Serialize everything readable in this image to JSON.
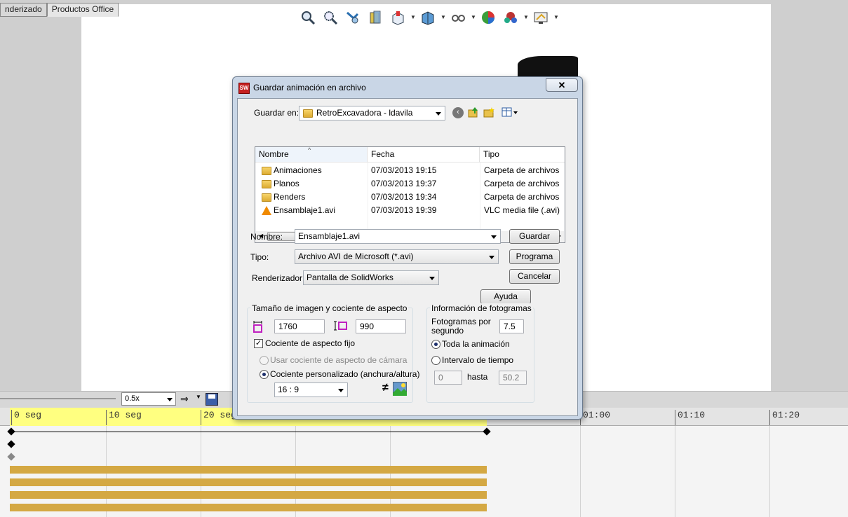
{
  "app": {
    "tabs": [
      "nderizado",
      "Productos Office"
    ],
    "toolbar_icons": [
      "zoom-to-fit-icon",
      "zoom-to-area-icon",
      "previous-view-icon",
      "section-view-icon",
      "view-orientation-icon",
      "display-style-icon",
      "hide-show-icon",
      "edit-appearance-icon",
      "apply-scene-icon",
      "view-settings-icon"
    ]
  },
  "dialog": {
    "title": "Guardar animación en archivo",
    "close_label": "✕",
    "save_in_label": "Guardar en:",
    "save_in_value": "RetroExcavadora - ldavila",
    "columns": [
      "Nombre",
      "Fecha",
      "Tipo"
    ],
    "files": [
      {
        "name": "Animaciones",
        "date": "07/03/2013 19:15",
        "type": "Carpeta de archivos",
        "icon": "folder-icon"
      },
      {
        "name": "Planos",
        "date": "07/03/2013 19:37",
        "type": "Carpeta de archivos",
        "icon": "folder-icon"
      },
      {
        "name": "Renders",
        "date": "07/03/2013 19:34",
        "type": "Carpeta de archivos",
        "icon": "folder-icon"
      },
      {
        "name": "Ensamblaje1.avi",
        "date": "07/03/2013 19:39",
        "type": "VLC media file (.avi)",
        "icon": "vlc-icon"
      }
    ],
    "name_label": "Nombre:",
    "name_value": "Ensamblaje1.avi",
    "type_label": "Tipo:",
    "type_value": "Archivo AVI de Microsoft (*.avi)",
    "renderer_label": "Renderizador:",
    "renderer_value": "Pantalla de SolidWorks",
    "buttons": {
      "save": "Guardar",
      "schedule": "Programa",
      "cancel": "Cancelar",
      "help": "Ayuda"
    },
    "image_group": {
      "title": "Tamaño de imagen y cociente de aspecto",
      "width": "1760",
      "height": "990",
      "fixed_aspect_label": "Cociente de aspecto fijo",
      "camera_aspect_label": "Usar cociente de aspecto de cámara",
      "custom_aspect_label": "Cociente personalizado (anchura/altura)",
      "ratio_value": "16 : 9",
      "not_equal_symbol": "≠"
    },
    "frames_group": {
      "title": "Información de fotogramas",
      "fps_label": "Fotogramas por segundo",
      "fps_value": "7.5",
      "whole_label": "Toda la animación",
      "interval_label": "Intervalo de tiempo",
      "from_value": "0",
      "to_label": "hasta",
      "to_value": "50.2"
    }
  },
  "timeline": {
    "zoom_value": "0.5x",
    "ticks": [
      "0 seg",
      "10 seg",
      "20 seg",
      "01:00",
      "01:10",
      "01:20"
    ]
  }
}
